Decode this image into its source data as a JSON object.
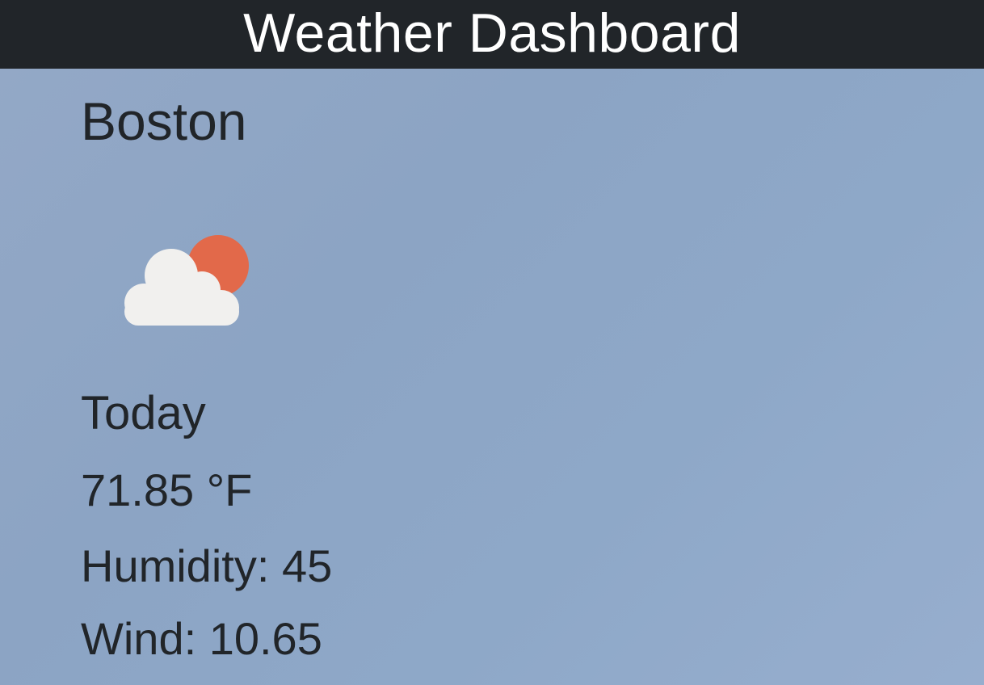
{
  "header": {
    "title": "Weather Dashboard"
  },
  "weather": {
    "city": "Boston",
    "icon": "partly-cloudy-day-icon",
    "day_label": "Today",
    "temperature": "71.85 °F",
    "humidity": "Humidity: 45",
    "wind": "Wind: 10.65"
  },
  "colors": {
    "header_bg": "#212529",
    "background": "#8ea6c6",
    "text": "#212529",
    "sun": "#e2694a",
    "cloud": "#f1f0ee"
  }
}
